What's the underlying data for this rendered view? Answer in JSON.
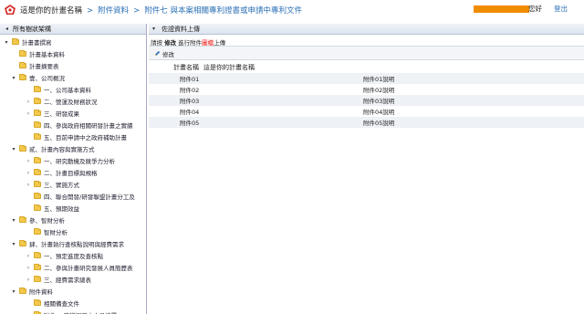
{
  "header": {
    "project_name": "這是你的計畫名稱",
    "crumbs": [
      "附件資料",
      "附件七 與本案相關專利證書或申請中專利文件"
    ],
    "greeting": "您好",
    "logout": "登出"
  },
  "sidebar": {
    "title": "所有樹狀架構",
    "nodes": [
      {
        "label": "計畫書撰寫",
        "toggle": "▾",
        "level": 0
      },
      {
        "label": "計畫基本資料",
        "toggle": "",
        "level": 1
      },
      {
        "label": "計畫摘要表",
        "toggle": "",
        "level": 1
      },
      {
        "label": "壹、公司概況",
        "toggle": "▾",
        "level": 1
      },
      {
        "label": "一、公司基本資料",
        "toggle": "",
        "level": 2
      },
      {
        "label": "二、營運及財務狀況",
        "toggle": "›",
        "level": 2
      },
      {
        "label": "三、研發成果",
        "toggle": "›",
        "level": 2
      },
      {
        "label": "四、參與政府相關研發計畫之實績",
        "toggle": "",
        "level": 2
      },
      {
        "label": "五、目前申請中之政府補助計畫",
        "toggle": "",
        "level": 2
      },
      {
        "label": "貳、計畫內容與實施方式",
        "toggle": "▾",
        "level": 1
      },
      {
        "label": "一、研究動機及競爭力分析",
        "toggle": "›",
        "level": 2
      },
      {
        "label": "二、計畫目標與規格",
        "toggle": "›",
        "level": 2
      },
      {
        "label": "三、實施方式",
        "toggle": "›",
        "level": 2
      },
      {
        "label": "四、聯合開發/研發聯盟計畫分工及",
        "toggle": "",
        "level": 2
      },
      {
        "label": "五、預期效益",
        "toggle": "",
        "level": 2
      },
      {
        "label": "參、智財分析",
        "toggle": "▾",
        "level": 1
      },
      {
        "label": "智財分析",
        "toggle": "",
        "level": 2
      },
      {
        "label": "肆、計畫執行查核點說明與經費需求",
        "toggle": "▾",
        "level": 1
      },
      {
        "label": "一、預定進度及查核點",
        "toggle": "›",
        "level": 2
      },
      {
        "label": "二、參與計畫研究發展人員簡歷表",
        "toggle": "›",
        "level": 2
      },
      {
        "label": "三、經費需求總表",
        "toggle": "›",
        "level": 2
      },
      {
        "label": "附件資料",
        "toggle": "▾",
        "level": 1
      },
      {
        "label": "相關備查文件",
        "toggle": "",
        "level": 2
      },
      {
        "label": "附件一 建議迴避之人員清單",
        "toggle": "",
        "level": 2
      }
    ]
  },
  "main": {
    "panel_title": "佐證資料上傳",
    "instruction": {
      "pre": "請按 ",
      "bold": "修改",
      "mid": " 進行附件",
      "red": "圖檔",
      "post": "上傳"
    },
    "edit_label": "修改",
    "project_label": "計畫名稱",
    "project_value": "這是你的計畫名稱",
    "rows": [
      {
        "name": "附件01",
        "desc": "附件01說明"
      },
      {
        "name": "附件02",
        "desc": "附件02說明"
      },
      {
        "name": "附件03",
        "desc": "附件03說明"
      },
      {
        "name": "附件04",
        "desc": "附件04說明"
      },
      {
        "name": "附件05",
        "desc": "附件05說明"
      }
    ]
  },
  "colors": {
    "accent": "#2a6fb5",
    "user_bar": "#f08c00",
    "highlight": "#e00000"
  }
}
